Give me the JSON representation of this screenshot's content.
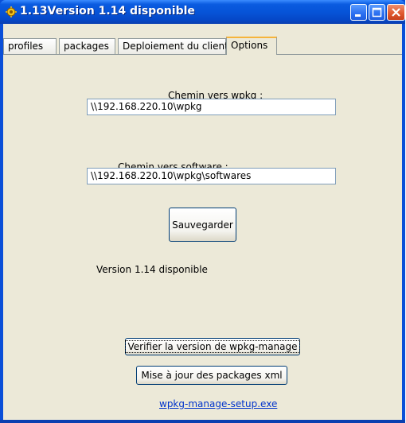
{
  "window": {
    "title": "1.13Version 1.14 disponible",
    "icon": "app-icon",
    "controls": [
      "minimize-icon",
      "maximize-icon",
      "close-icon"
    ]
  },
  "tabs": [
    {
      "label": "profiles",
      "active": false
    },
    {
      "label": "packages",
      "active": false
    },
    {
      "label": "Deploiement du client",
      "active": false
    },
    {
      "label": "Options",
      "active": true
    }
  ],
  "options": {
    "wpkg_label": "Chemin vers wpkg :",
    "wpkg_value": "\\\\192.168.220.10\\wpkg",
    "software_label": "Chemin vers software :",
    "software_value": "\\\\192.168.220.10\\wpkg\\softwares",
    "save_label": "Sauvegarder",
    "version_text": "Version 1.14 disponible",
    "verify_label": "Verifier la version de  wpkg-manage",
    "update_label": "Mise à jour des packages xml",
    "setup_link": "wpkg-manage-setup.exe"
  },
  "colors": {
    "titlebar": "#0654d8",
    "client_bg": "#ece9d8",
    "active_tab_accent": "#f6b43c",
    "link": "#0033cc",
    "close_button": "#e05a30"
  }
}
